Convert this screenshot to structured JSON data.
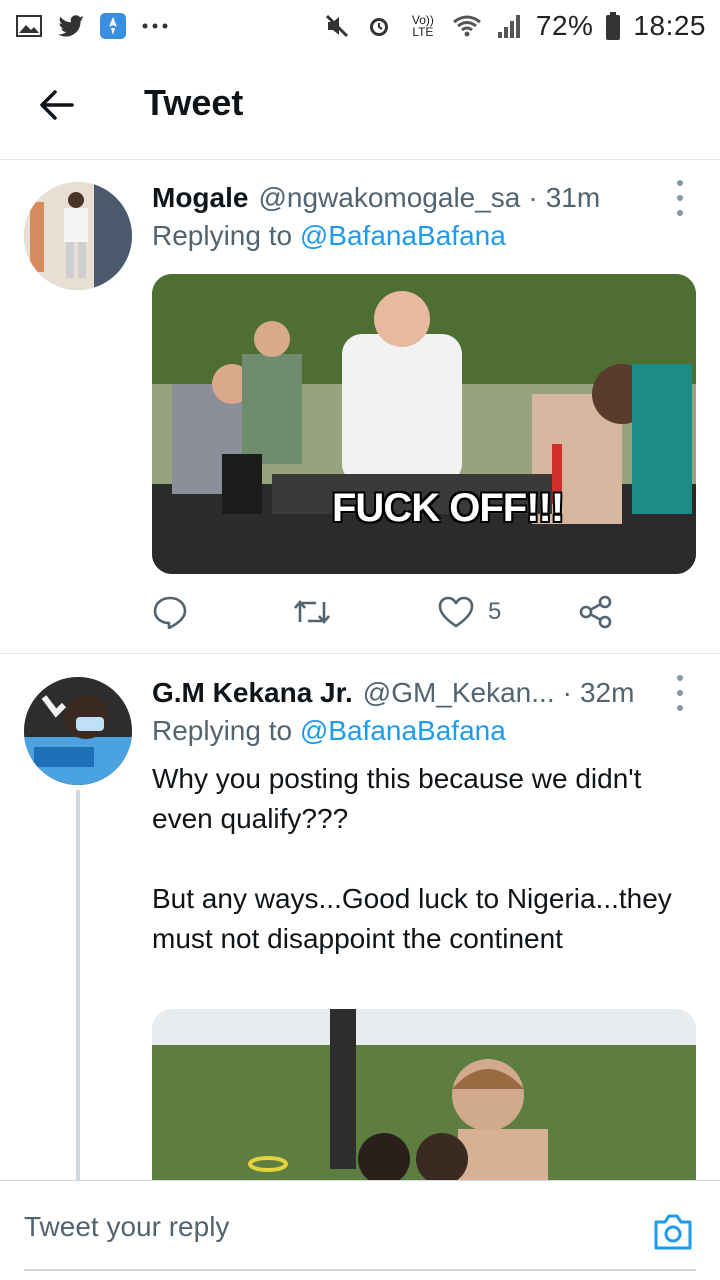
{
  "status_bar": {
    "battery": "72%",
    "time": "18:25",
    "network": "Vo)) LTE",
    "icons": [
      "gallery-icon",
      "twitter-icon",
      "app-icon",
      "more-dots-icon",
      "mute-icon",
      "alarm-icon",
      "wifi-icon",
      "signal-icon",
      "battery-icon"
    ]
  },
  "header": {
    "title": "Tweet",
    "back_icon": "arrow-left-icon"
  },
  "tweets": [
    {
      "name": "Mogale",
      "handle": "@ngwakomogale_sa",
      "dot": "·",
      "time": "31m",
      "replying_prefix": "Replying to",
      "replying_to": "@BafanaBafana",
      "media_caption": "FUCK OFF!!!",
      "actions": {
        "reply_count": "",
        "retweet_count": "",
        "like_count": "5",
        "share_icon": "share-icon"
      }
    },
    {
      "name": "G.M Kekana Jr.",
      "handle": "@GM_Kekan...",
      "dot": "·",
      "time": "32m",
      "replying_prefix": "Replying to",
      "replying_to": "@BafanaBafana",
      "text_1": "Why you posting this because we didn't even qualify???",
      "text_2": "But any ways...Good luck to Nigeria...they must not disappoint the continent"
    }
  ],
  "reply_bar": {
    "placeholder": "Tweet your reply",
    "camera_icon": "camera-icon"
  },
  "colors": {
    "accent": "#1d9bf0",
    "secondary_text": "#536471",
    "divider": "#e1e8ed"
  }
}
